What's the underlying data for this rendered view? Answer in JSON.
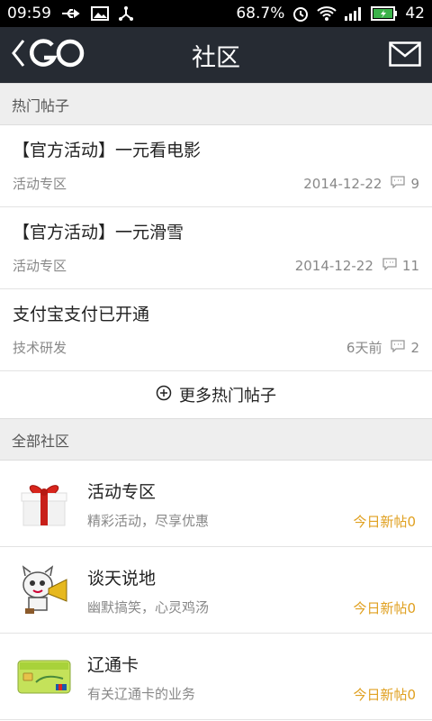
{
  "status_bar": {
    "time": "09:59",
    "battery_percent": "68.7%",
    "battery_level": "42",
    "icons": [
      "usb-icon",
      "image-icon",
      "share-icon",
      "alarm-icon",
      "wifi-icon",
      "signal-icon",
      "battery-icon"
    ]
  },
  "header": {
    "logo": "GO",
    "title": "社区",
    "icons": [
      "back-icon",
      "mail-icon"
    ]
  },
  "hot_posts": {
    "section_title": "热门帖子",
    "items": [
      {
        "title": "【官方活动】一元看电影",
        "category": "活动专区",
        "date": "2014-12-22",
        "comments": "9"
      },
      {
        "title": "【官方活动】一元滑雪",
        "category": "活动专区",
        "date": "2014-12-22",
        "comments": "11"
      },
      {
        "title": "支付宝支付已开通",
        "category": "技术研发",
        "date": "6天前",
        "comments": "2"
      }
    ],
    "more_label": "更多热门帖子"
  },
  "communities": {
    "section_title": "全部社区",
    "items": [
      {
        "name": "活动专区",
        "description": "精彩活动，尽享优惠",
        "new_posts": "今日新帖0",
        "icon": "gift-box-icon"
      },
      {
        "name": "谈天说地",
        "description": "幽默搞笑，心灵鸡汤",
        "new_posts": "今日新帖0",
        "icon": "cartoon-megaphone-icon"
      },
      {
        "name": "辽通卡",
        "description": "有关辽通卡的业务",
        "new_posts": "今日新帖0",
        "icon": "transit-card-icon"
      }
    ]
  },
  "colors": {
    "header_bg": "#262b33",
    "section_bg": "#eeeeee",
    "new_post_accent": "#e0a020",
    "battery_green": "#3bb34a"
  }
}
